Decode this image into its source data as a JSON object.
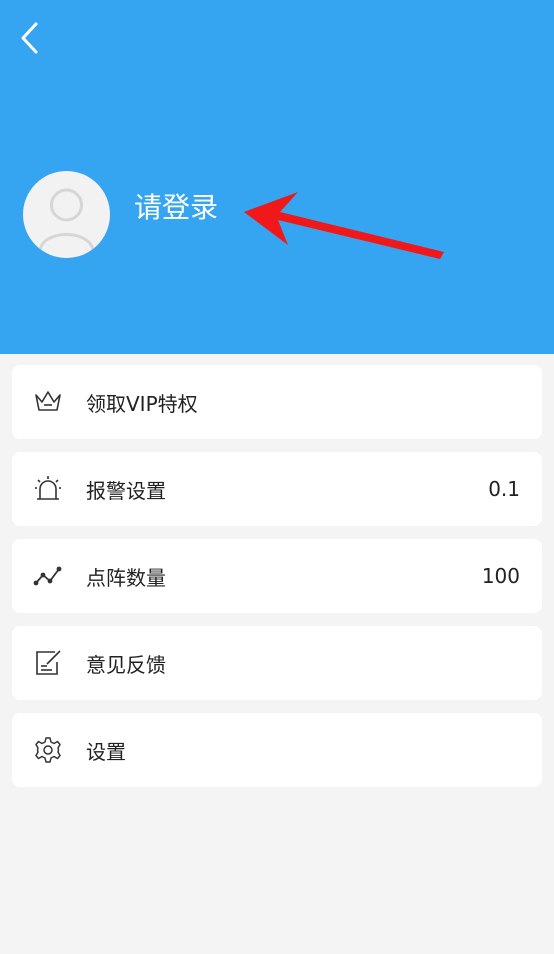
{
  "header": {
    "login_text": "请登录",
    "background": "#36a5f1",
    "back_icon": "back-chevron-icon",
    "avatar_icon": "default-avatar-icon",
    "annotation": "red-arrow-annotation"
  },
  "menu": {
    "items": [
      {
        "label": "领取VIP特权",
        "value": "",
        "icon": "crown-icon"
      },
      {
        "label": "报警设置",
        "value": "0.1",
        "icon": "alarm-light-icon"
      },
      {
        "label": "点阵数量",
        "value": "100",
        "icon": "line-graph-icon"
      },
      {
        "label": "意见反馈",
        "value": "",
        "icon": "feedback-edit-icon"
      },
      {
        "label": "设置",
        "value": "",
        "icon": "gear-icon"
      }
    ]
  }
}
